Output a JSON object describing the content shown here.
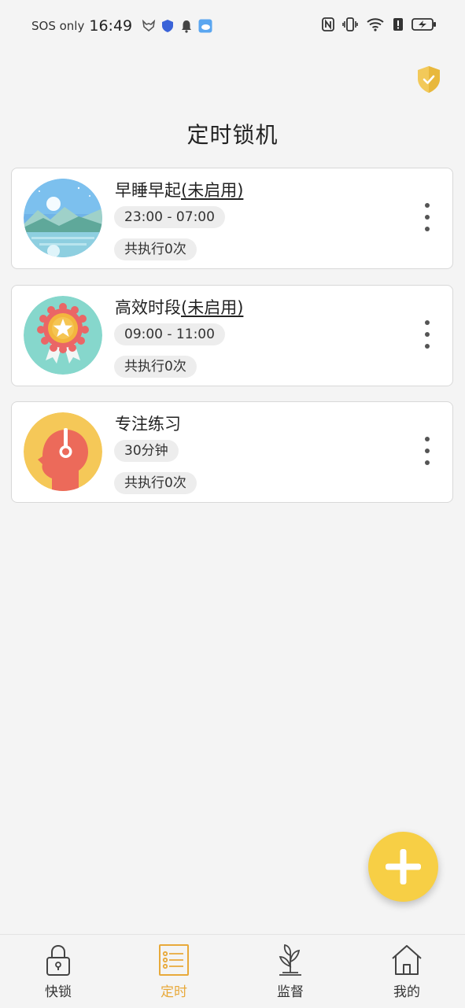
{
  "status_bar": {
    "carrier": "SOS only",
    "time": "16:49"
  },
  "page": {
    "title": "定时锁机"
  },
  "cards": [
    {
      "title": "早睡早起",
      "status": "(未启用)",
      "time_range": "23:00 - 07:00",
      "count": "共执行0次",
      "icon": "landscape-icon"
    },
    {
      "title": "高效时段",
      "status": "(未启用)",
      "time_range": "09:00 - 11:00",
      "count": "共执行0次",
      "icon": "medal-icon"
    },
    {
      "title": "专注练习",
      "status": "",
      "time_range": "30分钟",
      "count": "共执行0次",
      "icon": "head-focus-icon"
    }
  ],
  "bottom_nav": {
    "items": [
      {
        "label": "快锁",
        "icon": "lock-icon",
        "active": false
      },
      {
        "label": "定时",
        "icon": "schedule-list-icon",
        "active": true
      },
      {
        "label": "监督",
        "icon": "sprout-icon",
        "active": false
      },
      {
        "label": "我的",
        "icon": "home-icon",
        "active": false
      }
    ]
  },
  "colors": {
    "accent": "#f7cf45",
    "nav_active": "#e8a93a",
    "background": "#f4f4f4"
  }
}
